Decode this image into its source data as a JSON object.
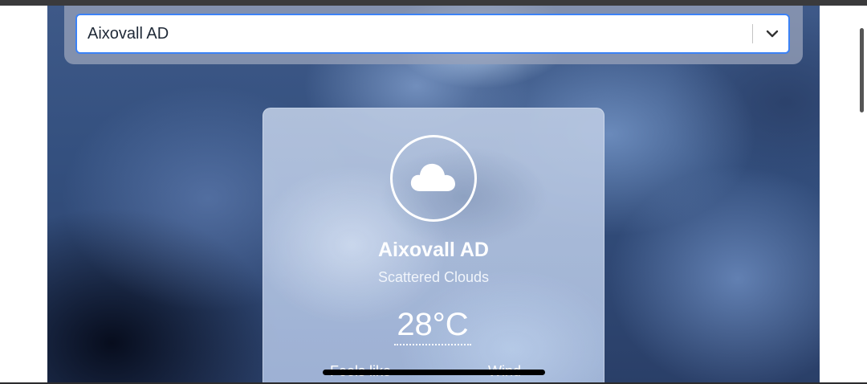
{
  "location_select": {
    "value": "Aixovall AD"
  },
  "weather": {
    "city": "Aixovall AD",
    "condition": "Scattered Clouds",
    "temperature": "28°C",
    "feels_like_label": "Feels like",
    "wind_label": "Wind"
  },
  "icons": {
    "weather": "cloud-icon",
    "dropdown": "chevron-down-icon"
  }
}
